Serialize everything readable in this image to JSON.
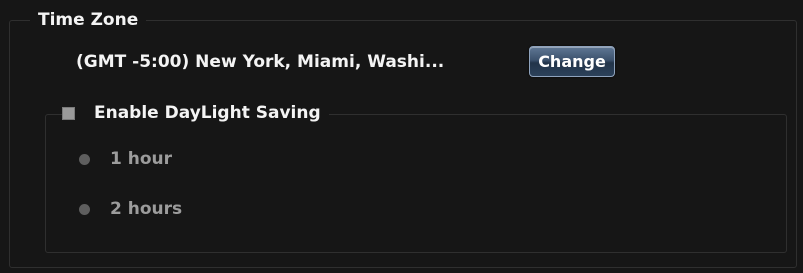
{
  "time_zone": {
    "title": "Time Zone",
    "current_value": "(GMT -5:00) New York, Miami, Washi...",
    "change_label": "Change"
  },
  "daylight_saving": {
    "checkbox_label": "Enable DayLight Saving",
    "checked": false,
    "options": [
      {
        "label": "1 hour",
        "selected": false
      },
      {
        "label": "2 hours",
        "selected": false
      }
    ],
    "options_enabled": false
  },
  "colors": {
    "background": "#161616",
    "text": "#f4f4f4",
    "disabled_text": "#9c9c9c",
    "button_accent": "#3c526d",
    "border": "#2f2f2f"
  }
}
